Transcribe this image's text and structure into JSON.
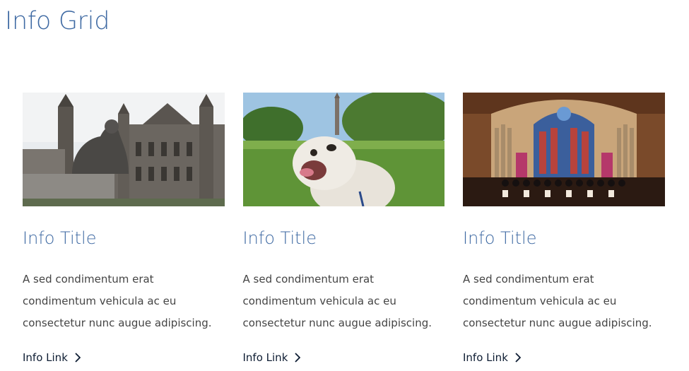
{
  "page": {
    "title": "Info Grid"
  },
  "cards": [
    {
      "title": "Info Title",
      "text": "A sed condimentum erat condimentum vehicula ac eu consectetur nunc augue adipiscing.",
      "link_label": "Info Link",
      "image_alt": "campus building with founder statue"
    },
    {
      "title": "Info Title",
      "text": "A sed condimentum erat condimentum vehicula ac eu consectetur nunc augue adipiscing.",
      "link_label": "Info Link",
      "image_alt": "bulldog on campus lawn"
    },
    {
      "title": "Info Title",
      "text": "A sed condimentum erat condimentum vehicula ac eu consectetur nunc augue adipiscing.",
      "link_label": "Info Link",
      "image_alt": "choir in chapel with stained glass"
    }
  ],
  "icons": {
    "link_arrow": "chevron-right-icon"
  },
  "colors": {
    "heading": "#3f6aa3",
    "body_text": "#444444",
    "link": "#0e1d33"
  }
}
